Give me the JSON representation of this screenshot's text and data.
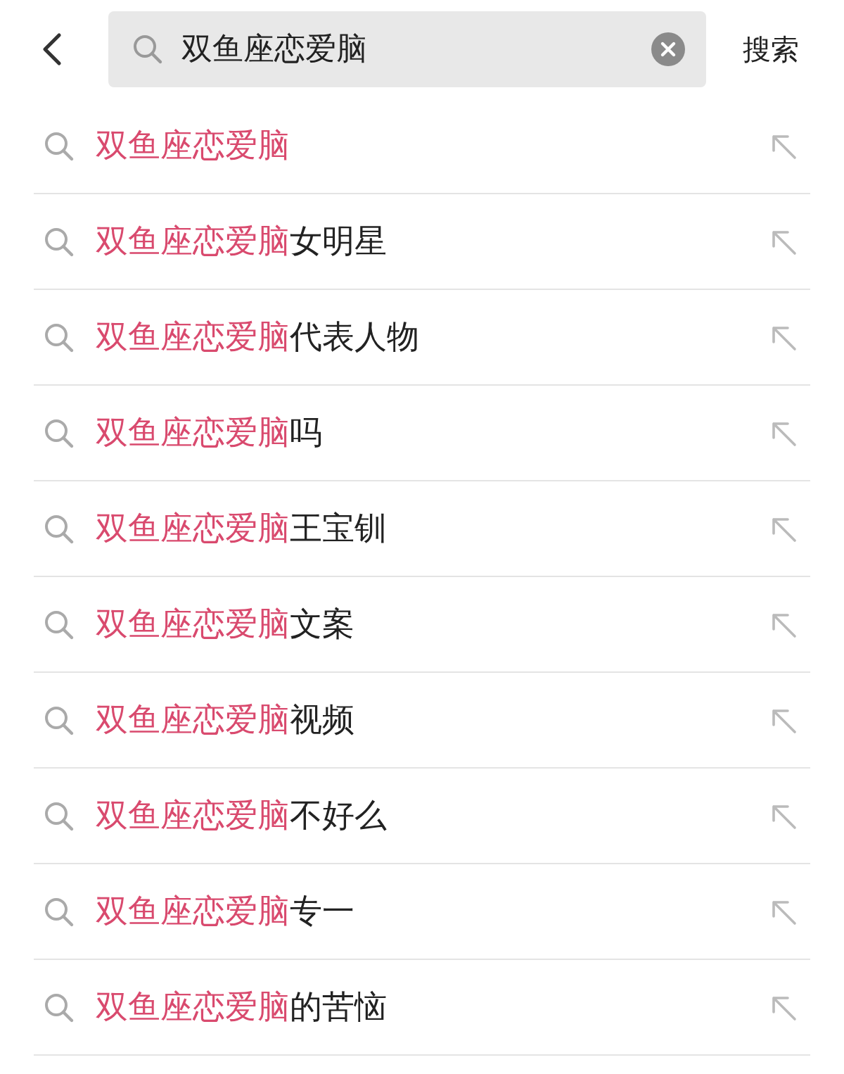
{
  "search": {
    "value": "双鱼座恋爱脑",
    "button": "搜索"
  },
  "suggestions": [
    {
      "match": "双鱼座恋爱脑"
    },
    {
      "match": "双鱼座恋爱脑",
      "rest": "女明星"
    },
    {
      "match": "双鱼座恋爱脑",
      "rest": "代表人物"
    },
    {
      "match": "双鱼座恋爱脑",
      "rest": "吗"
    },
    {
      "match": "双鱼座恋爱脑",
      "rest": "王宝钏"
    },
    {
      "match": "双鱼座恋爱脑",
      "rest": "文案"
    },
    {
      "match": "双鱼座恋爱脑",
      "rest": "视频"
    },
    {
      "match": "双鱼座恋爱脑",
      "rest": "不好么"
    },
    {
      "match": "双鱼座恋爱脑",
      "rest": "专一"
    },
    {
      "match": "双鱼座恋爱脑",
      "rest": "的苦恼"
    }
  ]
}
